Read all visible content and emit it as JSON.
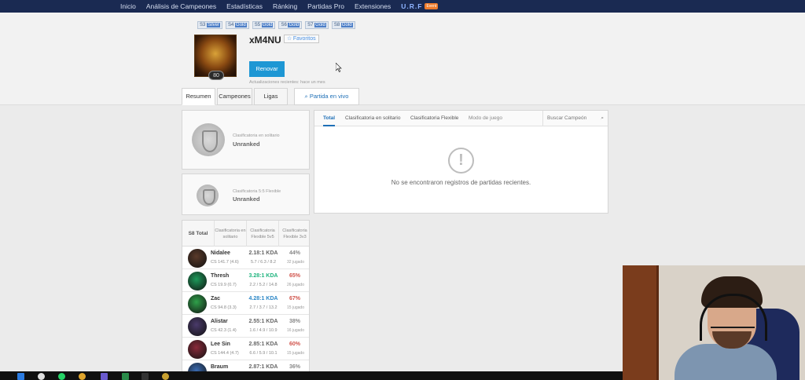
{
  "nav": {
    "items": [
      "Inicio",
      "Análisis de Campeones",
      "Estadísticas",
      "Ránking",
      "Partidas Pro",
      "Extensiones"
    ],
    "urf_label": "U.R.F",
    "event_badge": "Event"
  },
  "seasons": [
    {
      "season": "S3",
      "tier": "Silver"
    },
    {
      "season": "S4",
      "tier": "Gold"
    },
    {
      "season": "S5",
      "tier": "Gold"
    },
    {
      "season": "S6",
      "tier": "Gold"
    },
    {
      "season": "S7",
      "tier": "Gold"
    },
    {
      "season": "S8",
      "tier": "Gold"
    }
  ],
  "profile": {
    "summoner_name": "xM4NU",
    "favorite_label": "Favoritos",
    "level": "80",
    "renew_label": "Renovar",
    "updated_text": "Actualizaciones recientes: hace un mes"
  },
  "tabs": {
    "resumen": "Resumen",
    "campeones": "Campeones",
    "ligas": "Ligas",
    "live": "Partida en vivo"
  },
  "ranked": {
    "solo_label": "Clasificatoria en solitario",
    "solo_value": "Unranked",
    "flex_label": "Clasificatoria 5:5 Flexible",
    "flex_value": "Unranked"
  },
  "stats_table": {
    "headers": [
      "S8 Total",
      "Clasificatoria en solitario",
      "Clasificatoria Flexible 5v5",
      "Clasificatoria Flexible 3v3"
    ],
    "rows": [
      {
        "champion": "Nidalee",
        "cs": "CS 141.7 (4.6)",
        "kda": "2.18:1 KDA",
        "kda_detail": "5.7 / 6.3 / 8.2",
        "winrate": "44%",
        "games": "32 jugado",
        "kda_color": "#666666",
        "wr_color": "#888888",
        "avatar": "#5a3a2a"
      },
      {
        "champion": "Thresh",
        "cs": "CS 19.9 (0.7)",
        "kda": "3.28:1 KDA",
        "kda_detail": "2.2 / 5.2 / 14.8",
        "winrate": "65%",
        "games": "26 jugado",
        "kda_color": "#1fb47e",
        "wr_color": "#d0524a",
        "avatar": "#1d9a5a"
      },
      {
        "champion": "Zac",
        "cs": "CS 94.8 (3.3)",
        "kda": "4.28:1 KDA",
        "kda_detail": "2.7 / 3.7 / 13.2",
        "winrate": "67%",
        "games": "15 jugado",
        "kda_color": "#2a86c6",
        "wr_color": "#d0524a",
        "avatar": "#2fa14a"
      },
      {
        "champion": "Alistar",
        "cs": "CS 42.3 (1.4)",
        "kda": "2.55:1 KDA",
        "kda_detail": "1.6 / 4.9 / 10.9",
        "winrate": "38%",
        "games": "16 jugado",
        "kda_color": "#666666",
        "wr_color": "#888888",
        "avatar": "#4a3a6a"
      },
      {
        "champion": "Lee Sin",
        "cs": "CS 144.4 (4.7)",
        "kda": "2.85:1 KDA",
        "kda_detail": "6.6 / 5.9 / 10.1",
        "winrate": "60%",
        "games": "15 jugado",
        "kda_color": "#666666",
        "wr_color": "#d0524a",
        "avatar": "#8a2a3a"
      },
      {
        "champion": "Braum",
        "cs": "",
        "kda": "2.87:1 KDA",
        "kda_detail": "",
        "winrate": "36%",
        "games": "",
        "kda_color": "#666666",
        "wr_color": "#888888",
        "avatar": "#3a6ab0"
      }
    ]
  },
  "matches": {
    "tabs": [
      "Total",
      "Clasificatoria en solitario",
      "Clasificatoria Flexible",
      "Modo de juego"
    ],
    "search_placeholder": "Buscar Campeón",
    "empty_text": "No se encontraron registros de partidas recientes."
  }
}
